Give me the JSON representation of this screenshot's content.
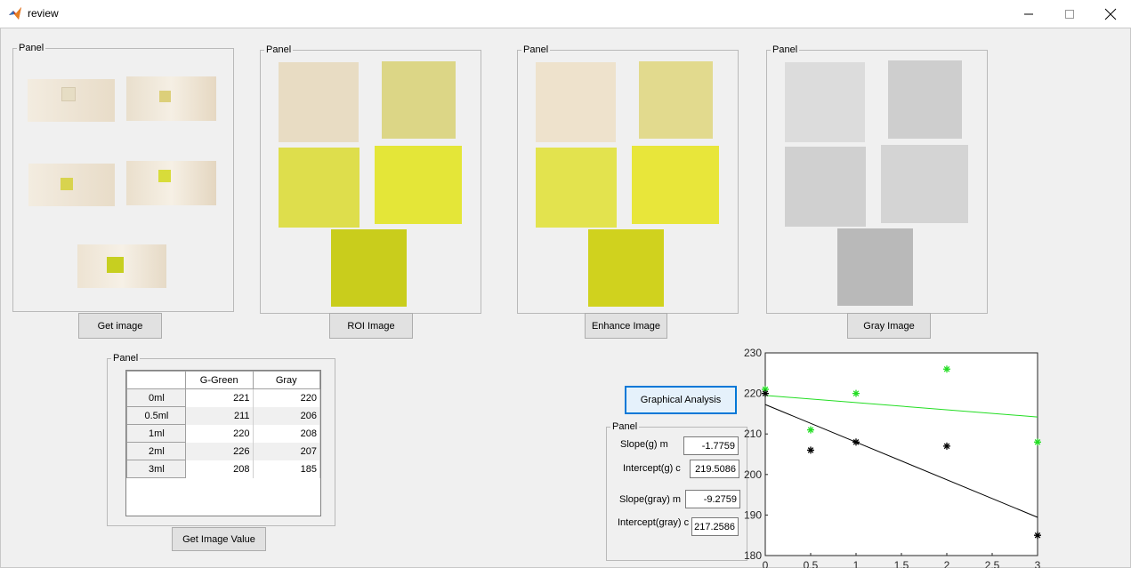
{
  "window": {
    "title": "review",
    "minimize_glyph": "─",
    "maximize_glyph": "☐",
    "close_glyph": "✕"
  },
  "panels": {
    "original": {
      "title": "Panel",
      "button": "Get image"
    },
    "roi": {
      "title": "Panel",
      "button": "ROI Image"
    },
    "enhance": {
      "title": "Panel",
      "button": "Enhance Image"
    },
    "gray": {
      "title": "Panel",
      "button": "Gray Image"
    },
    "table_panel": {
      "title": "Panel",
      "button": "Get Image Value"
    },
    "results": {
      "title": "Panel"
    }
  },
  "table": {
    "columns": [
      "G-Green",
      "Gray"
    ],
    "rows": [
      {
        "label": "0ml",
        "g": "221",
        "gray": "220"
      },
      {
        "label": "0.5ml",
        "g": "211",
        "gray": "206"
      },
      {
        "label": "1ml",
        "g": "220",
        "gray": "208"
      },
      {
        "label": "2ml",
        "g": "226",
        "gray": "207"
      },
      {
        "label": "3ml",
        "g": "208",
        "gray": "185"
      }
    ]
  },
  "analysis": {
    "button": "Graphical Analysis",
    "slope_g_label": "Slope(g) m",
    "slope_g": "-1.7759",
    "intercept_g_label": "Intercept(g) c",
    "intercept_g": "219.5086",
    "slope_gray_label": "Slope(gray) m",
    "slope_gray": "-9.2759",
    "intercept_gray_label": "Intercept(gray) c",
    "intercept_gray": "217.2586"
  },
  "colors": {
    "green_series": "#22dd22",
    "gray_series": "#000000",
    "accent": "#0078d7"
  },
  "chart_data": {
    "type": "scatter",
    "xlim": [
      0,
      3
    ],
    "ylim": [
      180,
      230
    ],
    "xticks": [
      "0",
      "0.5",
      "1",
      "1.5",
      "2",
      "2.5",
      "3"
    ],
    "yticks": [
      "230",
      "220",
      "210",
      "200",
      "190",
      "180"
    ],
    "series": [
      {
        "color": "#22dd22",
        "x": [
          0,
          0.5,
          1,
          2,
          3
        ],
        "y": [
          221,
          211,
          220,
          226,
          208
        ],
        "fit": {
          "m": -1.7759,
          "c": 219.5086
        }
      },
      {
        "color": "#000000",
        "x": [
          0,
          0.5,
          1,
          2,
          3
        ],
        "y": [
          220,
          206,
          208,
          207,
          185
        ],
        "fit": {
          "m": -9.2759,
          "c": 217.2586
        }
      }
    ]
  }
}
